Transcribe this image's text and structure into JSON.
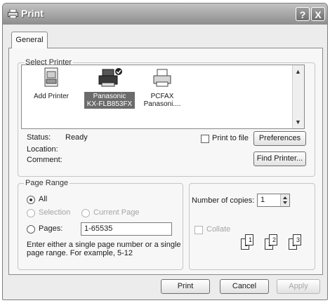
{
  "window": {
    "title": "Print",
    "help_button": "?",
    "close_button": "X"
  },
  "tabs": [
    {
      "label": "General"
    }
  ],
  "select_printer": {
    "legend": "Select Printer",
    "printers": [
      {
        "name_line1": "Add Printer",
        "name_line2": ""
      },
      {
        "name_line1": "Panasonic",
        "name_line2": "KX-FLB853FX"
      },
      {
        "name_line1": "PCFAX",
        "name_line2": "Panasoni...."
      }
    ],
    "status_label": "Status:",
    "status_value": "Ready",
    "location_label": "Location:",
    "comment_label": "Comment:",
    "print_to_file_label": "Print to file",
    "preferences_label": "Preferences",
    "find_printer_label": "Find Printer..."
  },
  "page_range": {
    "legend": "Page Range",
    "all_label": "All",
    "selection_label": "Selection",
    "current_page_label": "Current Page",
    "pages_label": "Pages:",
    "pages_value": "1-65535",
    "hint_line1": "Enter either a single page number or a single",
    "hint_line2": "page range.  For example, 5-12"
  },
  "copies": {
    "number_label": "Number of copies:",
    "number_value": "1",
    "collate_label": "Collate",
    "page_numbers": [
      "1",
      "1",
      "2",
      "2",
      "3",
      "3"
    ]
  },
  "buttons": {
    "print": "Print",
    "cancel": "Cancel",
    "apply": "Apply"
  }
}
